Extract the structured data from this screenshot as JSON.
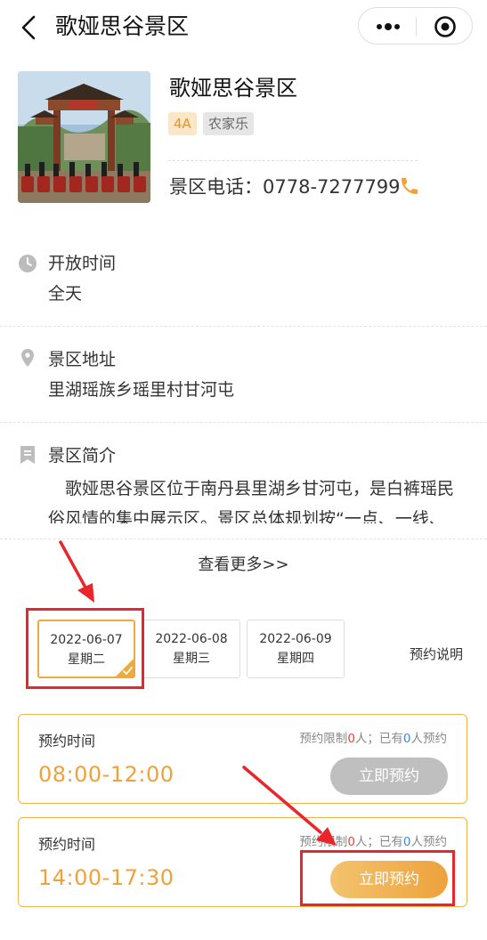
{
  "nav": {
    "title": "歌娅思谷景区"
  },
  "scenic": {
    "name": "歌娅思谷景区",
    "tags": [
      "4A",
      "农家乐"
    ],
    "phone_label": "景区电话：0778-7277799"
  },
  "info": {
    "hours_title": "开放时间",
    "hours_value": "全天",
    "address_title": "景区地址",
    "address_value": "里湖瑶族乡瑶里村甘河屯",
    "intro_title": "景区简介",
    "intro_text": "歌娅思谷景区位于南丹县里湖乡甘河屯，是白裤瑶民俗风情的集中展示区。景区总体规划按“一点、一线、",
    "see_more": "查看更多>>"
  },
  "dates": [
    {
      "date": "2022-06-07",
      "weekday": "星期二",
      "selected": true
    },
    {
      "date": "2022-06-08",
      "weekday": "星期三",
      "selected": false
    },
    {
      "date": "2022-06-09",
      "weekday": "星期四",
      "selected": false
    }
  ],
  "booking_note": "预约说明",
  "slots": [
    {
      "label": "预约时间",
      "time": "08:00-12:00",
      "quota_prefix": "预约限制",
      "limit": "0",
      "quota_mid": "人；已有",
      "booked": "0",
      "quota_suffix": "人预约",
      "button": "立即预约",
      "enabled": false
    },
    {
      "label": "预约时间",
      "time": "14:00-17:30",
      "quota_prefix": "预约限制",
      "limit": "0",
      "quota_mid": "人；已有",
      "booked": "0",
      "quota_suffix": "人预约",
      "button": "立即预约",
      "enabled": true
    }
  ],
  "colors": {
    "accent": "#f0a23a",
    "annotation": "#e8262b",
    "disabled_button": "#bfbfbf"
  },
  "icons": [
    "back-arrow-icon",
    "more-dots-icon",
    "close-target-icon",
    "phone-icon",
    "clock-icon",
    "location-pin-icon",
    "bookmark-icon",
    "checkmark-icon"
  ]
}
